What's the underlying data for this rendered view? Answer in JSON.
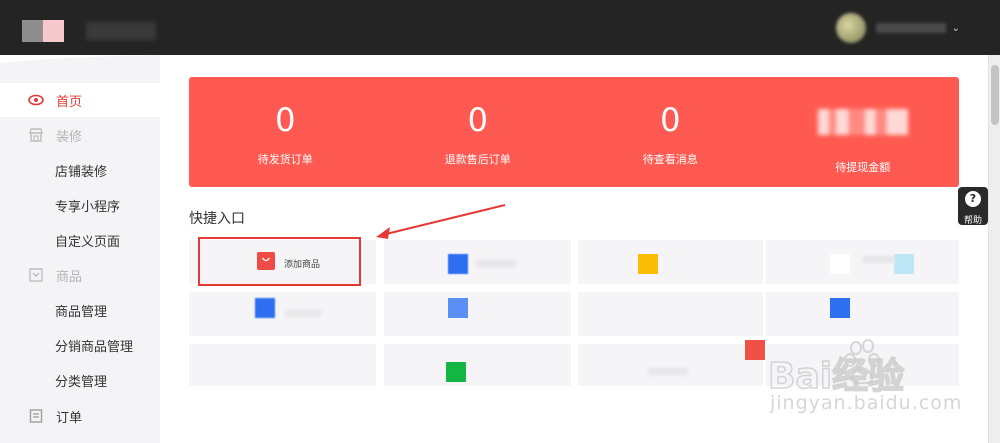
{
  "header": {
    "user_caret": "⌄"
  },
  "sidebar": {
    "items": [
      {
        "label": "首页",
        "type": "active"
      },
      {
        "label": "装修",
        "type": "group"
      },
      {
        "label": "店铺装修",
        "type": "sub"
      },
      {
        "label": "专享小程序",
        "type": "sub"
      },
      {
        "label": "自定义页面",
        "type": "sub"
      },
      {
        "label": "商品",
        "type": "group"
      },
      {
        "label": "商品管理",
        "type": "sub"
      },
      {
        "label": "分销商品管理",
        "type": "sub"
      },
      {
        "label": "分类管理",
        "type": "sub"
      },
      {
        "label": "订单",
        "type": "item"
      }
    ]
  },
  "stats": [
    {
      "value": "0",
      "label": "待发货订单"
    },
    {
      "value": "0",
      "label": "退款售后订单"
    },
    {
      "value": "0",
      "label": "待查看消息"
    },
    {
      "value": "",
      "label": "待提现金额"
    }
  ],
  "quick_entry": {
    "title": "快捷入口",
    "add_product_label": "添加商品"
  },
  "help": {
    "icon": "?",
    "label": "帮助"
  },
  "watermark": {
    "text": "jingyan.baidu.com",
    "logo": "Bai经验"
  },
  "colors": {
    "accent": "#e53935",
    "stats_bg": "#ff5a51",
    "topbar": "#242424"
  }
}
